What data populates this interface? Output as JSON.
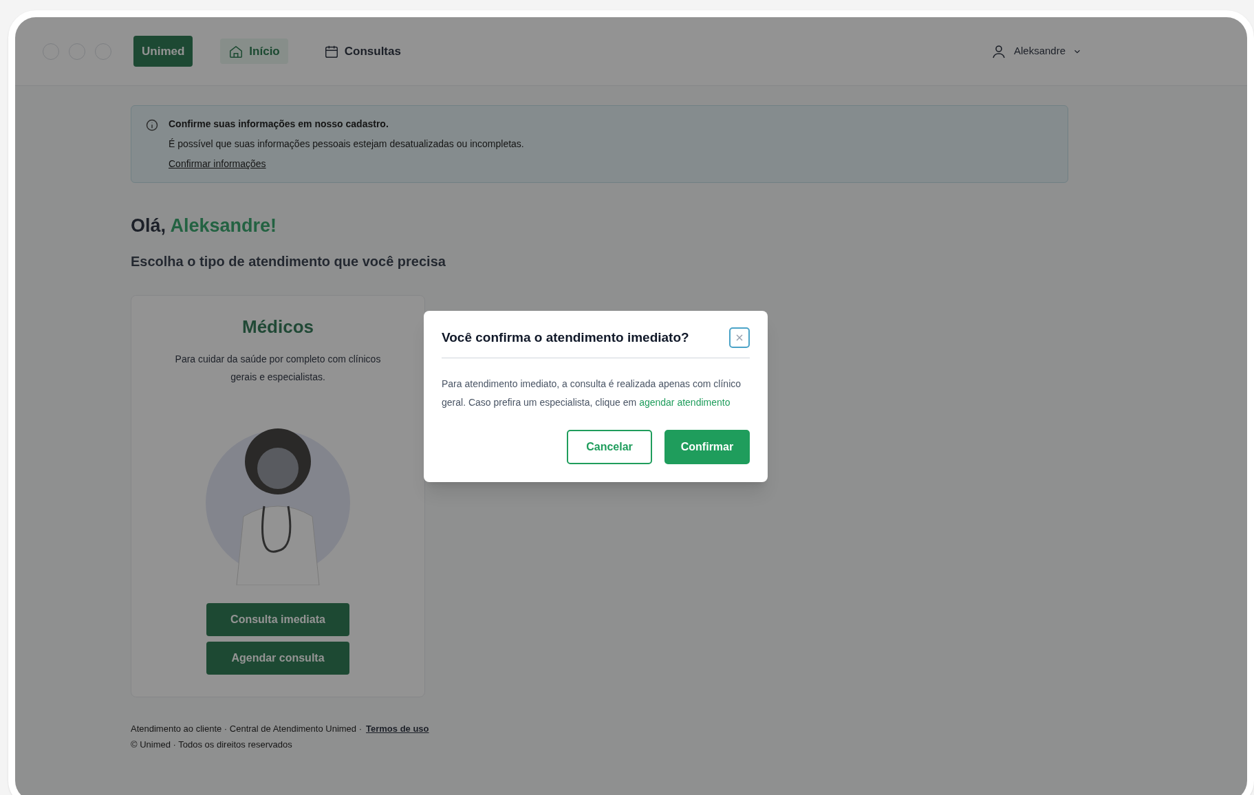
{
  "navbar": {
    "logo": "Unimed",
    "items": [
      {
        "label": "Início",
        "selected": true
      },
      {
        "label": "Consultas",
        "selected": false
      }
    ],
    "user": "Aleksandre"
  },
  "banner": {
    "title": "Confirme suas informações em nosso cadastro.",
    "text": "É possível que suas informações pessoais estejam desatualizadas ou incompletas.",
    "link": "Confirmar informações"
  },
  "greeting": {
    "prefix": "Olá,",
    "name": "Aleksandre!",
    "subtitle": "Escolha o tipo de atendimento que você precisa"
  },
  "card": {
    "title": "Médicos",
    "description": "Para cuidar da saúde por completo com clínicos gerais e especialistas.",
    "buttons": [
      "Consulta imediata",
      "Agendar consulta"
    ]
  },
  "footer": {
    "text": "Atendimento ao cliente · Central de Atendimento Unimed ·",
    "link": "Termos de uso",
    "copyright": "© Unimed · Todos os direitos reservados"
  },
  "modal": {
    "title": "Você confirma o atendimento imediato?",
    "body": "Para atendimento imediato, a consulta é realizada apenas com clínico geral. Caso prefira um especialista, clique em",
    "link": "agendar atendimento",
    "buttons": [
      {
        "label": "Cancelar",
        "kind": "secondary"
      },
      {
        "label": "Confirmar",
        "kind": "primary"
      }
    ]
  }
}
